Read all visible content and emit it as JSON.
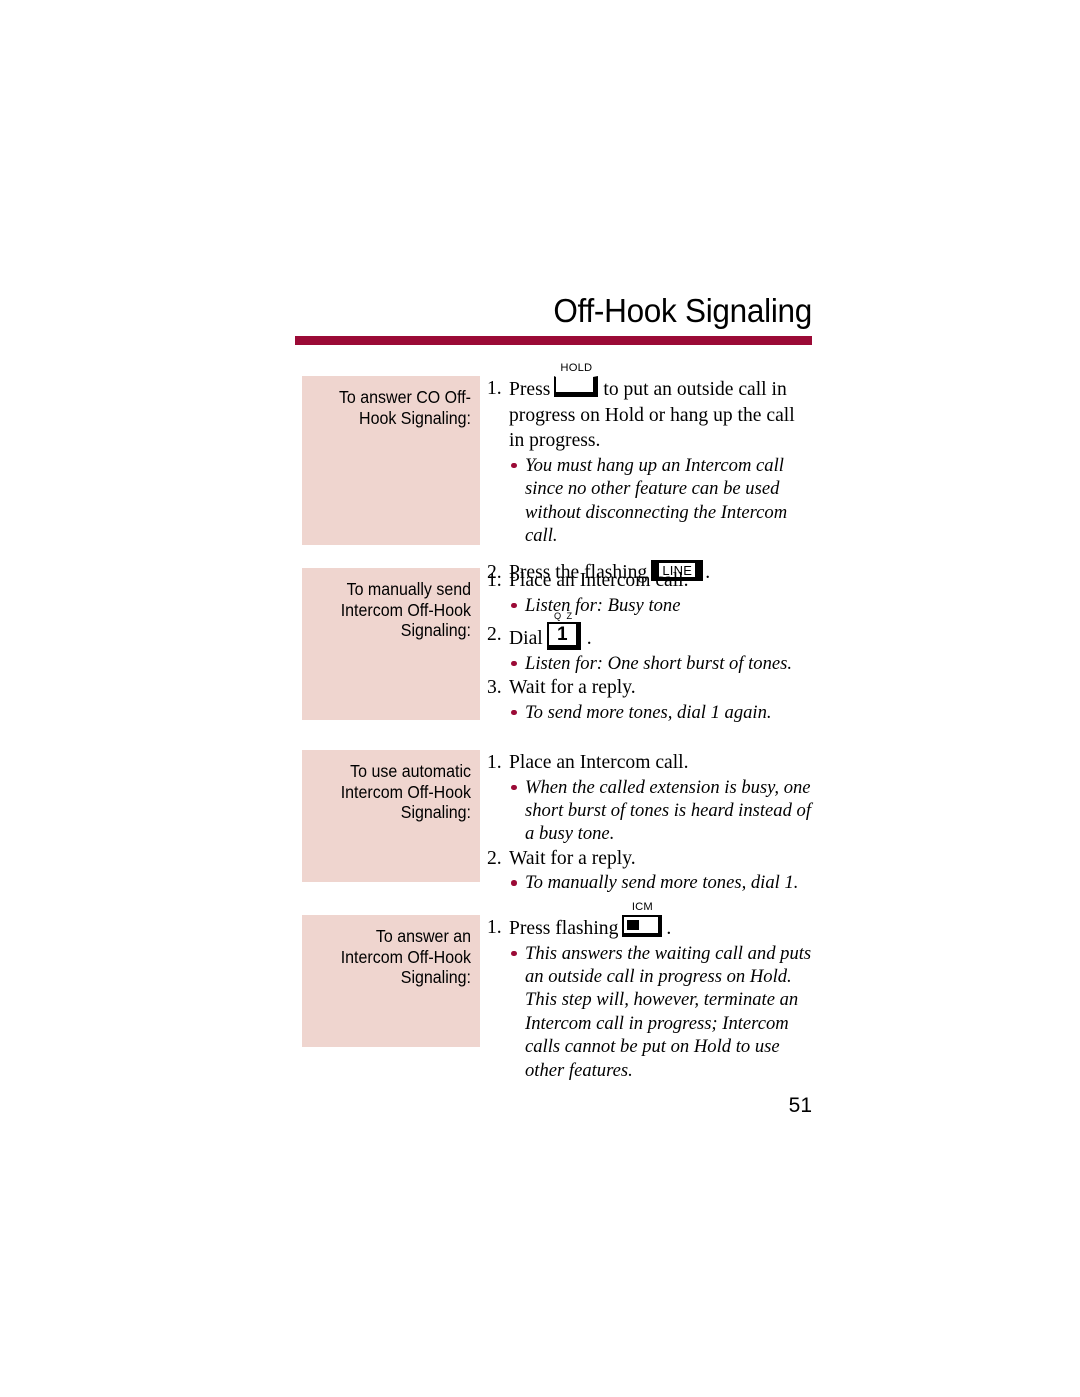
{
  "document": {
    "title": "Off-Hook Signaling",
    "page_number": "51",
    "accent_color": "#9b0a36",
    "label_box_color": "#efd5cf"
  },
  "sections": [
    {
      "label": "To answer CO Off-\nHook Signaling:",
      "steps": [
        {
          "number": "1.",
          "text_before": "Press",
          "key": {
            "type": "hold-key",
            "caption": "HOLD",
            "face": ""
          },
          "text_after": "to put an outside call in progress on Hold or hang up the call in progress."
        }
      ],
      "note1": "You must hang up an Intercom call since no other feature can be used without disconnecting the Intercom call.",
      "step2": {
        "number": "2.",
        "text_before": "Press the flashing",
        "key": {
          "type": "line-key",
          "caption": "",
          "face": "LINE"
        },
        "text_after": "."
      }
    },
    {
      "label": "To manually send\nIntercom Off-Hook\nSignaling:",
      "step1": {
        "number": "1.",
        "text": "Place an Intercom call."
      },
      "note1": "Listen for: Busy tone",
      "step2": {
        "number": "2.",
        "text_before": "Dial",
        "key": {
          "type": "dial-key",
          "caption": "Q Z",
          "face": "1"
        },
        "text_after": "."
      },
      "note2": "Listen for: One short burst of tones.",
      "step3": {
        "number": "3.",
        "text": "Wait for a reply."
      },
      "note3": "To send more tones, dial 1 again."
    },
    {
      "label": "To use automatic\nIntercom Off-Hook\nSignaling:",
      "step1": {
        "number": "1.",
        "text": "Place an Intercom call."
      },
      "note1": "When the called extension is busy, one short burst of tones is heard instead of a busy tone.",
      "step2": {
        "number": "2.",
        "text": "Wait for a reply."
      },
      "note2": "To manually send more tones, dial 1."
    },
    {
      "label": "To answer an\nIntercom Off-Hook\nSignaling:",
      "step1": {
        "number": "1.",
        "text_before": "Press flashing",
        "key": {
          "type": "icm-key",
          "caption": "ICM",
          "face": ""
        },
        "text_after": "."
      },
      "note1": "This answers the waiting call and puts an outside call in progress on Hold. This step will, however, terminate an Intercom call in progress; Intercom calls cannot be put on Hold to use other features."
    }
  ]
}
